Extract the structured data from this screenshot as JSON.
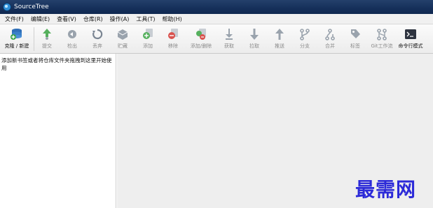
{
  "window": {
    "title": "SourceTree"
  },
  "menu": {
    "items": [
      "文件(F)",
      "编辑(E)",
      "查看(V)",
      "仓库(R)",
      "操作(A)",
      "工具(T)",
      "帮助(H)"
    ]
  },
  "toolbar": {
    "clone_new": "克隆 / 新建",
    "commit": "提交",
    "checkout": "检出",
    "discard": "丢弃",
    "stash": "贮藏",
    "add": "添加",
    "remove": "移除",
    "add_remove": "添加/删除",
    "fetch": "获取",
    "pull": "拉取",
    "push": "推送",
    "branch": "分支",
    "merge": "合并",
    "tag": "标签",
    "git_flow": "Git工作流",
    "terminal": "命令行模式"
  },
  "sidebar": {
    "hint": "添加新书签或者将仓库文件夹拖拽到这里开始使用"
  },
  "watermark": {
    "text": "最需网"
  },
  "colors": {
    "accent": "#2c8ad8",
    "disabled_icon": "#9aa3ad",
    "watermark": "#2c2ad8"
  }
}
